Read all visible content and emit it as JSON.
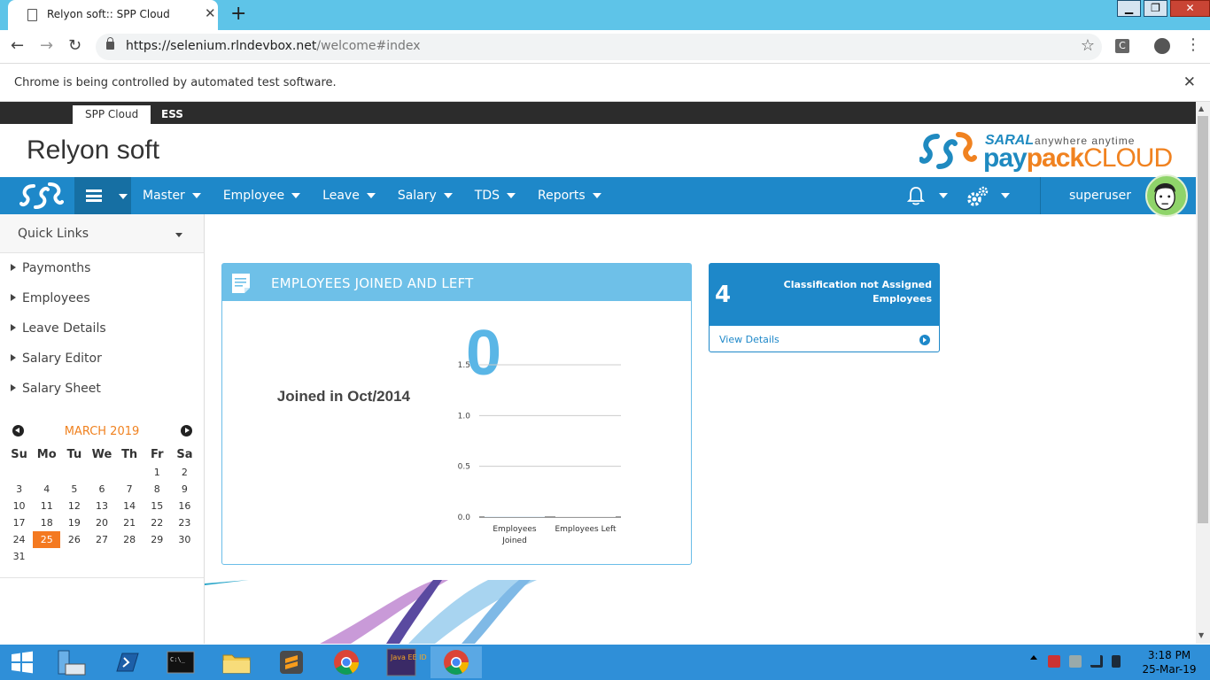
{
  "browser": {
    "tab_title": "Relyon soft:: SPP Cloud",
    "new_tab_symbol": "+",
    "url_domain": "https://selenium.rlndevbox.net",
    "url_path": "/welcome#index",
    "infobar_text": "Chrome is being controlled by automated test software.",
    "ext_label": "C"
  },
  "portal_tabs": [
    {
      "label": "SPP Cloud",
      "active": true
    },
    {
      "label": "ESS",
      "active": false
    }
  ],
  "header": {
    "company_name": "Relyon soft",
    "logo_saral": "SARAL",
    "logo_tagline": "anywhere anytime",
    "logo_pay": "pay",
    "logo_pack": "pack",
    "logo_cloud": "CLOUD"
  },
  "nav": {
    "items": [
      "Master",
      "Employee",
      "Leave",
      "Salary",
      "TDS",
      "Reports"
    ],
    "username": "superuser"
  },
  "sidebar": {
    "quick_links_title": "Quick Links",
    "links": [
      "Paymonths",
      "Employees",
      "Leave Details",
      "Salary Editor",
      "Salary Sheet"
    ]
  },
  "calendar": {
    "title": "MARCH 2019",
    "weekdays": [
      "Su",
      "Mo",
      "Tu",
      "We",
      "Th",
      "Fr",
      "Sa"
    ],
    "weeks": [
      [
        "",
        "",
        "",
        "",
        "",
        "1",
        "2"
      ],
      [
        "3",
        "4",
        "5",
        "6",
        "7",
        "8",
        "9"
      ],
      [
        "10",
        "11",
        "12",
        "13",
        "14",
        "15",
        "16"
      ],
      [
        "17",
        "18",
        "19",
        "20",
        "21",
        "22",
        "23"
      ],
      [
        "24",
        "25",
        "26",
        "27",
        "28",
        "29",
        "30"
      ],
      [
        "31",
        "",
        "",
        "",
        "",
        "",
        ""
      ]
    ],
    "today": "25"
  },
  "widget": {
    "title": "EMPLOYEES JOINED AND LEFT",
    "count": "0",
    "label": "Joined in Oct/2014"
  },
  "chart_data": {
    "type": "bar",
    "categories": [
      "Employees Joined",
      "Employees Left"
    ],
    "values": [
      0,
      0
    ],
    "y_ticks": [
      "0.0",
      "0.5",
      "1.0",
      "1.5"
    ],
    "ylim": [
      0,
      1.5
    ],
    "grid": true
  },
  "info_card": {
    "count": "4",
    "text": "Classification not Assigned Employees",
    "link": "View Details"
  },
  "taskbar": {
    "time": "3:18 PM",
    "date": "25-Mar-19",
    "java_label": "Java EE IDE"
  },
  "colors": {
    "nav_blue": "#1e88c9",
    "widget_head": "#6ec0e8",
    "accent_orange": "#f47920",
    "taskbar": "#2f8fd8"
  }
}
